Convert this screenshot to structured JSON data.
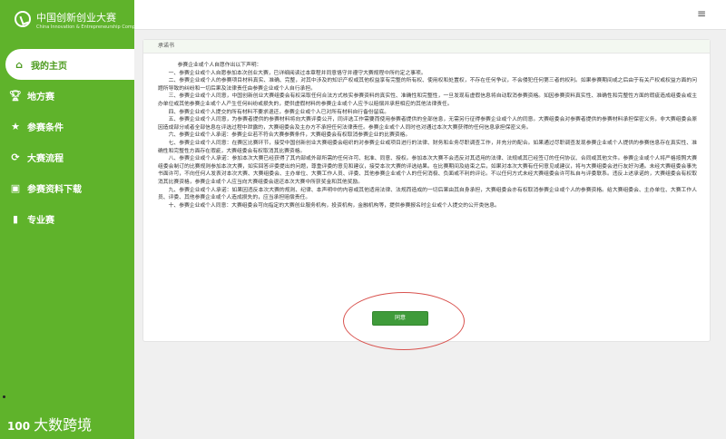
{
  "app": {
    "logo_cn": "中国创新创业大赛",
    "logo_en": "China Innovation & Entrepreneurship Competition",
    "footer_brand_prefix": "100",
    "footer_brand": "大数跨境"
  },
  "sidebar": {
    "items": [
      {
        "label": "我的主页",
        "icon": "home-icon",
        "active": true
      },
      {
        "label": "地方赛",
        "icon": "trophy-icon",
        "active": false
      },
      {
        "label": "参赛条件",
        "icon": "star-icon",
        "active": false
      },
      {
        "label": "大赛流程",
        "icon": "sync-icon",
        "active": false
      },
      {
        "label": "参赛资料下载",
        "icon": "download-icon",
        "active": false
      },
      {
        "label": "专业赛",
        "icon": "book-icon",
        "active": false
      }
    ]
  },
  "topbar": {
    "menu_icon": "hamburger-menu-icon"
  },
  "panel": {
    "title": "承诺书",
    "intro": "参赛企业或个人自愿作出以下声明：",
    "paragraphs": [
      "一、参赛企业或个人自愿参加本次创业大赛，已详细阅读过本章程并同意恪守并遵守大赛规程中所约定之事项。",
      "二、参赛企业或个人的参赛项目材料真实、准确、完整，对其中涉及的知识产权或其他权益享有完整的所有权、使用权和处置权，不存在任何争议，不会侵犯任何第三者的权利。如果参赛期间或之后由于有关产权或权益方面的问题所导致的纠纷和一切后果及法律责任由参赛企业或个人自行承担。",
      "三、参赛企业或个人同意，中国创新创业大赛组委会有权采取任何合法方式核实参赛资料的真实性、准确性和完整性，一旦发现有虚假信息将自动取消参赛资格。如因参赛资料真实性、准确性和完整性方面的瑕疵造成组委会或主办单位或其他参赛企业或个人产生任何纠纷或损失的，提供虚假材料的参赛企业或个人应予以赔偿并承担相应的其他法律责任。",
      "四、参赛企业或个人提交的所有材料不要求退还，参赛企业或个人已对所有材料自行备份留底。",
      "五、参赛企业或个人同意，为参赛者提供的参赛材料将向大赛评委公开，同评选工作需要而使用参赛者提供的全部信息，无需另行征得参赛企业或个人的同意。大赛组委会对参赛者提供的参赛材料承担保密义务，非大赛组委会原因造成部分或者全部信息在评选过程中泄露的，大赛组委会及主办方不承担任何法律责任。参赛企业或个人同时也对通过本次大赛获得的任何信息承担保密义务。",
      "六、参赛企业或个人承诺：参赛企业若不符合大赛参赛条件，大赛组委会有权取消参赛企业的比赛资格。",
      "七、参赛企业或个人同意：在赛区比赛环节，接受中国创新创业大赛组委会组织的对参赛企业或项目进行的法律、财务和业务尽职调查工作，并充分的配合。如果通过尽职调查发现参赛企业或个人提供的参赛信息存在真实性、准确性和完整性方面存在瑕疵，大赛组委会有权取消其比赛资格。",
      "八、参赛企业或个人承诺：参加本次大赛已经获得了其内部或外部所需的任何许可、批准、同意、授权。参加本次大赛不会违反对其适用的法律、法规或其已经签订的任何协议、合同或其他文件。参赛企业或个人将严格按照大赛组委会制订的比赛规则参加本次大赛，如实回答评委提出的问题，尊重评委的意见和建议，接受本次大赛的评选结果。在比赛期间及结束之后，如果对本次大赛有任何意见或建议，将与大赛组委会进行友好沟通。未经大赛组委会事先书面许可，不向任何人发表对本次大赛、大赛组委会、主办单位、大赛工作人员、评委、其他参赛企业或个人的任何消极、负面或不利的评论。不以任何方式未经大赛组委会许可私自与评委联系。违反上述承诺的，大赛组委会有权取消其比赛资格，参赛企业或个人应当向大赛组委会退还本次大赛中所获奖金和其他奖励。",
      "九、参赛企业或个人承诺：如果因违反本次大赛的规则、纪律、本声明中的内容或其他适用法律、法规而造成的一切后果由其自身承担，大赛组委会亦有权取消参赛企业或个人的参赛资格。给大赛组委会、主办单位、大赛工作人员、评委、其他参赛企业或个人造成损失的，应当承担赔偿责任。",
      "十、参赛企业或个人同意：大赛组委会可向指定的大赛创业服务机构，投资机构，金融机构等，提供参赛报名时企业或个人提交的公开类信息。"
    ],
    "agree_button": "同意"
  },
  "colors": {
    "sidebar_green": "#5fb32b",
    "button_green": "#3f9b3a",
    "highlight_ring": "#d9534f"
  }
}
